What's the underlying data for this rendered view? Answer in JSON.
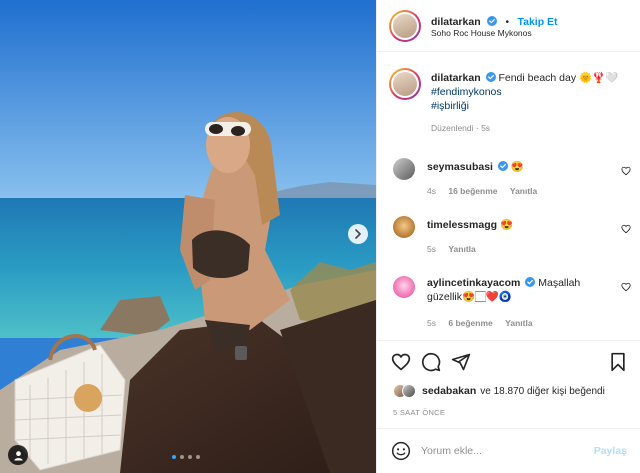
{
  "post": {
    "image_alt": "Woman in sunglasses and bikini sitting on a beach lounger by the sea",
    "carousel": {
      "count": 4,
      "active": 1
    }
  },
  "header": {
    "username": "dilatarkan",
    "separator": "•",
    "follow_label": "Takip Et",
    "location": "Soho Roc House Mykonos"
  },
  "caption": {
    "username": "dilatarkan",
    "text": "Fendi beach day 🌞🦞🤍",
    "tag1": "#fendimykonos",
    "tag2": "#işbirliği",
    "meta": "Düzenlendi · 5s"
  },
  "comments": [
    {
      "username": "seymasubasi",
      "text": "😍",
      "time": "4s",
      "likes": "16 beğenme",
      "reply": "Yanıtla"
    },
    {
      "username": "timelessmagg",
      "text": "😍",
      "time": "5s",
      "reply": "Yanıtla"
    },
    {
      "username": "aylincetinkayacom",
      "text": "Maşallah güzellik😍🏻❤️🧿",
      "time": "5s",
      "likes": "6 beğenme",
      "reply": "Yanıtla"
    }
  ],
  "likes": {
    "first_user": "sedabakan",
    "rest": "ve 18.870 diğer kişi beğendi"
  },
  "timestamp": "5 SAAT ÖNCE",
  "add_comment": {
    "placeholder": "Yorum ekle...",
    "post_label": "Paylaş"
  },
  "colors": {
    "accent": "#0095f6",
    "verified": "#3897f0",
    "muted": "#8e8e8e",
    "text": "#262626"
  }
}
